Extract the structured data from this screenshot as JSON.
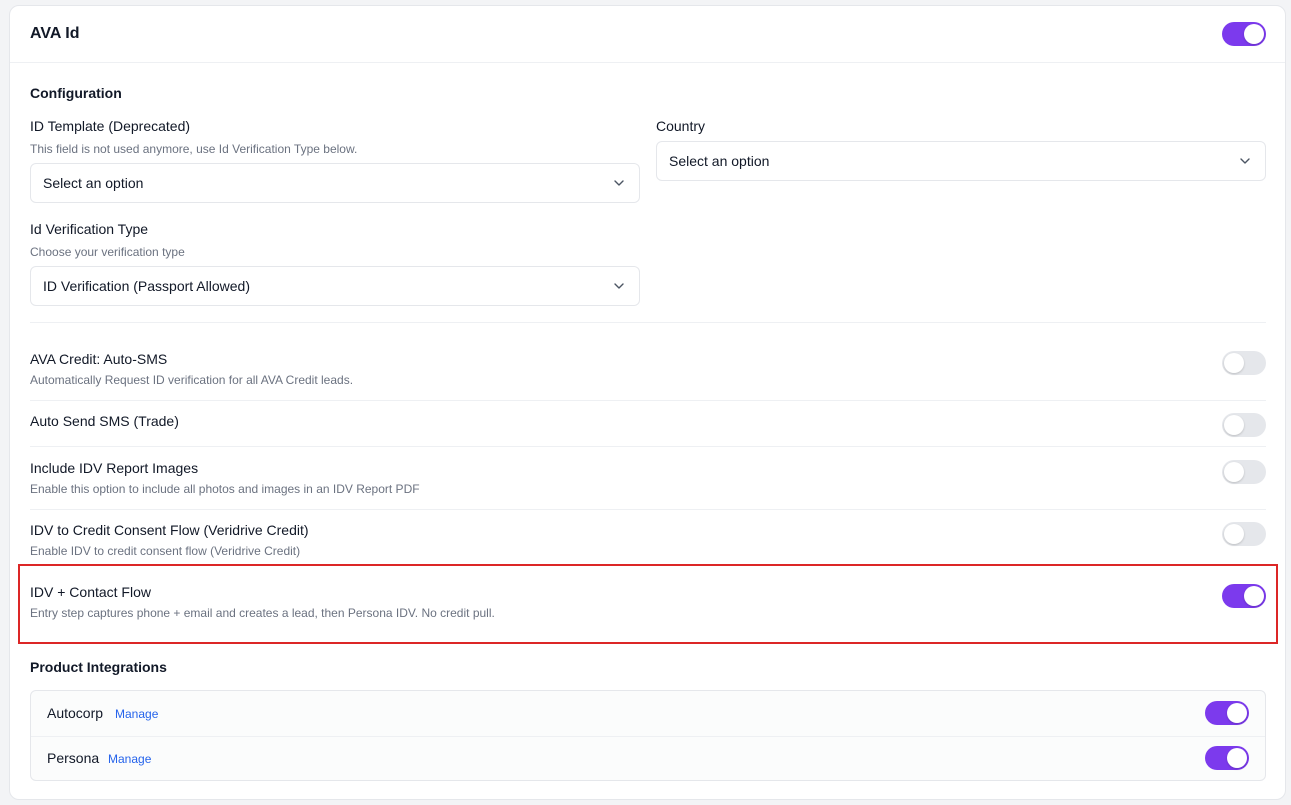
{
  "header": {
    "title": "AVA Id",
    "enabled": true
  },
  "configuration": {
    "title": "Configuration",
    "id_template": {
      "label": "ID Template (Deprecated)",
      "help": "This field is not used anymore, use Id Verification Type below.",
      "value": "Select an option"
    },
    "country": {
      "label": "Country",
      "value": "Select an option"
    },
    "verification_type": {
      "label": "Id Verification Type",
      "help": "Choose your verification type",
      "value": "ID Verification (Passport Allowed)"
    }
  },
  "settings": [
    {
      "label": "AVA Credit: Auto-SMS",
      "help": "Automatically Request ID verification for all AVA Credit leads.",
      "enabled": false
    },
    {
      "label": "Auto Send SMS (Trade)",
      "help": "",
      "enabled": false
    },
    {
      "label": "Include IDV Report Images",
      "help": "Enable this option to include all photos and images in an IDV Report PDF",
      "enabled": false
    },
    {
      "label": "IDV to Credit Consent Flow (Veridrive Credit)",
      "help": "Enable IDV to credit consent flow (Veridrive Credit)",
      "enabled": false
    },
    {
      "label": "IDV + Contact Flow",
      "help": "Entry step captures phone + email and creates a lead, then Persona IDV. No credit pull.",
      "enabled": true
    }
  ],
  "integrations": {
    "title": "Product Integrations",
    "items": [
      {
        "name": "Autocorp",
        "link": "Manage",
        "enabled": true
      },
      {
        "name": "Persona",
        "link": "Manage",
        "enabled": true
      }
    ]
  },
  "colors": {
    "accent": "#7c3aed",
    "highlight": "#dc2626",
    "link": "#2563eb"
  }
}
